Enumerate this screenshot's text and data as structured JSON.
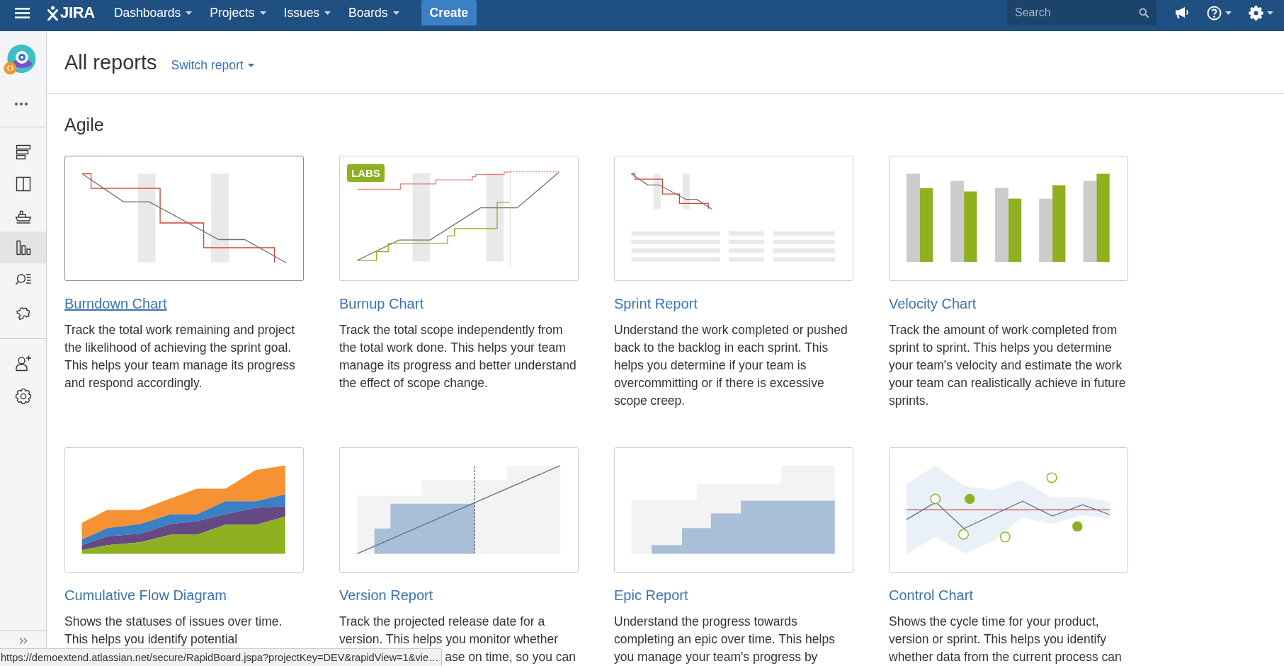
{
  "header": {
    "product": "JIRA",
    "nav": [
      {
        "label": "Dashboards"
      },
      {
        "label": "Projects"
      },
      {
        "label": "Issues"
      },
      {
        "label": "Boards"
      }
    ],
    "create": "Create",
    "search": {
      "placeholder": "Search"
    }
  },
  "sidebar": {
    "sections": [
      {
        "items": [
          {
            "kind": "backlog",
            "selected": false
          },
          {
            "kind": "board",
            "selected": false
          },
          {
            "kind": "releases",
            "selected": false
          },
          {
            "kind": "reports",
            "selected": true
          },
          {
            "kind": "issues",
            "selected": false
          },
          {
            "kind": "components",
            "selected": false
          }
        ]
      },
      {
        "items": [
          {
            "kind": "people",
            "selected": false
          },
          {
            "kind": "settings",
            "selected": false
          }
        ]
      }
    ]
  },
  "page": {
    "title": "All reports",
    "switch_report": "Switch report",
    "section": "Agile",
    "reports": [
      {
        "kind": "burndown",
        "title": "Burndown Chart",
        "hovered": true,
        "description": [
          "Track the total work remaining and project",
          "the likelihood of achieving the sprint goal.",
          "This helps your team manage its progress",
          "and respond accordingly."
        ]
      },
      {
        "kind": "burnup",
        "title": "Burnup Chart",
        "hovered": false,
        "badge": "LABS",
        "description": [
          "Track the total scope independently from",
          "the total work done. This helps your team",
          "manage its progress and better understand",
          "the effect of scope change."
        ]
      },
      {
        "kind": "sprint",
        "title": "Sprint Report",
        "hovered": false,
        "description": [
          "Understand the work completed or pushed",
          "back to the backlog in each sprint. This",
          "helps you determine if your team is",
          "overcommitting or if there is excessive",
          "scope creep."
        ]
      },
      {
        "kind": "velocity",
        "title": "Velocity Chart",
        "hovered": false,
        "description": [
          "Track the amount of work completed from",
          "sprint to sprint. This helps you determine",
          "your team's velocity and estimate the work",
          "your team can realistically achieve in future",
          "sprints."
        ]
      },
      {
        "kind": "cfd",
        "title": "Cumulative Flow Diagram",
        "hovered": false,
        "description": [
          "Shows the statuses of issues over time.",
          "This helps you identify potential"
        ]
      },
      {
        "kind": "version",
        "title": "Version Report",
        "hovered": false,
        "description": [
          "Track the projected release date for a",
          "version. This helps you monitor whether"
        ],
        "description_tail": "ase on time, so you can"
      },
      {
        "kind": "epic",
        "title": "Epic Report",
        "hovered": false,
        "description": [
          "Understand the progress towards",
          "completing an epic over time. This helps",
          "you manage your team's progress by"
        ]
      },
      {
        "kind": "control",
        "title": "Control Chart",
        "hovered": false,
        "description": [
          "Shows the cycle time for your product,",
          "version or sprint. This helps you identify",
          "whether data from the current process can"
        ]
      }
    ]
  },
  "status_bar": {
    "url": "https://demoextend.atlassian.net/secure/RapidBoard.jspa?projectKey=DEV&rapidView=1&vie…"
  }
}
